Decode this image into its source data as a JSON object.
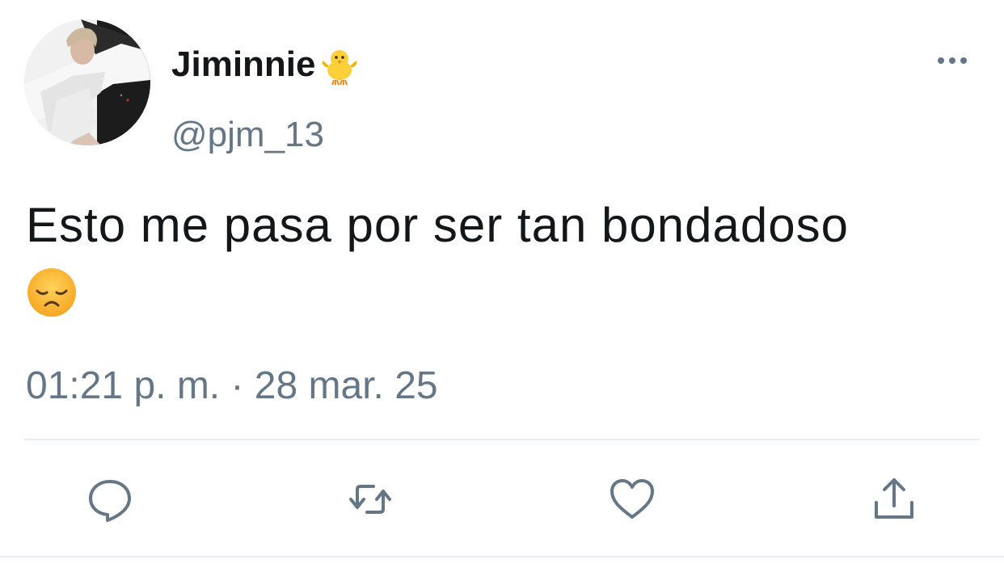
{
  "tweet": {
    "display_name": "Jiminnie",
    "display_name_emoji": "baby-chick-icon",
    "handle": "@pjm_13",
    "text": "Esto me pasa por ser tan bondadoso",
    "text_emoji": "disappointed-face-icon",
    "timestamp": "01:21 p. m. · 28 mar. 25"
  },
  "actions": [
    {
      "icon": "reply-icon"
    },
    {
      "icon": "retweet-icon"
    },
    {
      "icon": "like-icon"
    },
    {
      "icon": "share-icon"
    }
  ],
  "colors": {
    "text": "#14171a",
    "secondary": "#657786",
    "divider": "#e6ecf0",
    "icon": "#657786"
  }
}
